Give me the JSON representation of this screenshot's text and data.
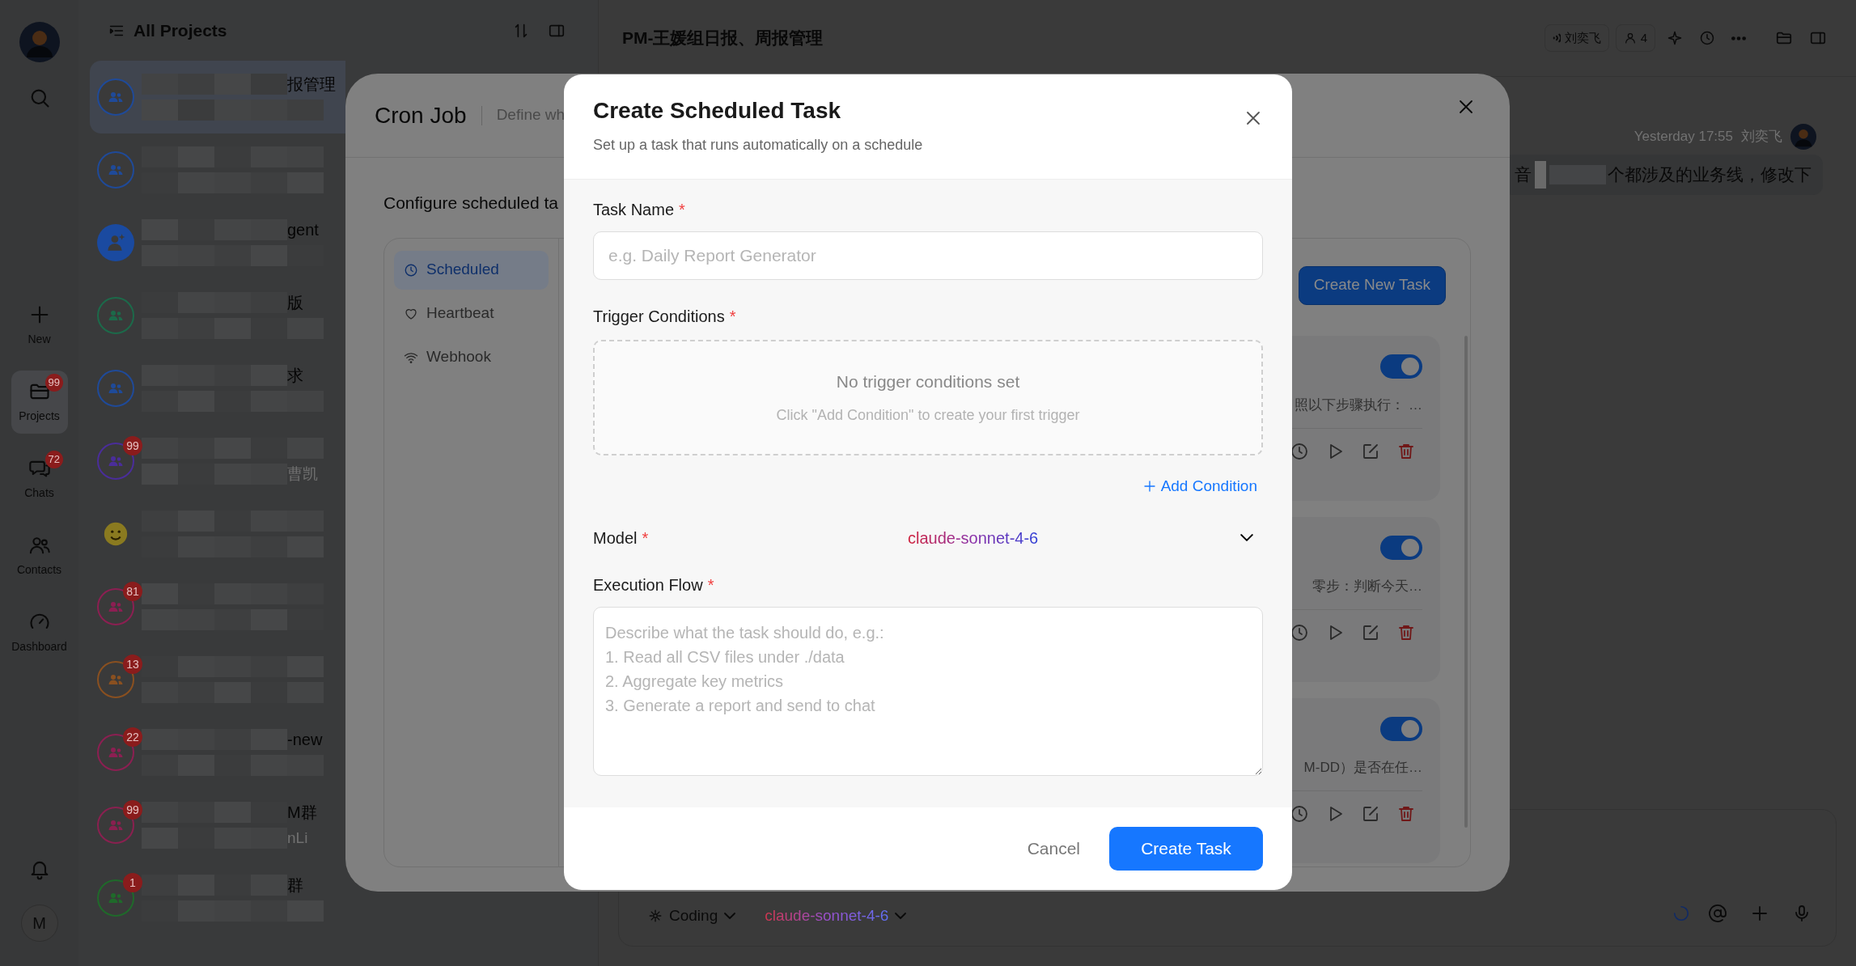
{
  "rail": {
    "items": [
      {
        "kind": "new",
        "label": "New",
        "selected": false
      },
      {
        "kind": "projects",
        "label": "Projects",
        "badge": "99",
        "selected": true
      },
      {
        "kind": "chats",
        "label": "Chats",
        "badge": "72",
        "selected": false
      },
      {
        "kind": "contacts",
        "label": "Contacts",
        "selected": false
      },
      {
        "kind": "dashboard",
        "label": "Dashboard",
        "selected": false
      }
    ],
    "user_initial": "M"
  },
  "projects": {
    "title": "All Projects",
    "items": [
      {
        "kind": "group",
        "color": "#1f4a99",
        "selected": true,
        "title": "报管理"
      },
      {
        "kind": "group",
        "color": "#1f4a99",
        "selected": false
      },
      {
        "kind": "bot",
        "color": "#1a4aa0",
        "selected": false,
        "title": "gent"
      },
      {
        "kind": "group",
        "color": "#1c6a4a",
        "selected": false,
        "title": "版"
      },
      {
        "kind": "group",
        "color": "#1f4a99",
        "selected": false,
        "title": "求"
      },
      {
        "kind": "group",
        "color": "#4a2d9a",
        "selected": false,
        "badge": "99",
        "subtitle": "曹凯"
      },
      {
        "kind": "emoji",
        "color": "#8a7a20",
        "selected": false
      },
      {
        "kind": "group",
        "color": "#8c1f52",
        "selected": false,
        "badge": "81"
      },
      {
        "kind": "group",
        "color": "#8a5020",
        "selected": false,
        "badge": "13"
      },
      {
        "kind": "group",
        "color": "#8c1f52",
        "selected": false,
        "badge": "22",
        "title": "-new"
      },
      {
        "kind": "group",
        "color": "#8a2050",
        "selected": false,
        "badge": "99",
        "title": "M群",
        "subtitle": "nLi"
      },
      {
        "kind": "group",
        "color": "#1f6a2a",
        "selected": false,
        "badge": "1",
        "title": "群"
      }
    ]
  },
  "chat": {
    "title": "PM-王媛组日报、周报管理",
    "speaker": "刘奕飞",
    "member_count": "4",
    "message": {
      "time": "Yesterday 17:55",
      "sender": "刘奕飞",
      "text_start": "音",
      "text_end": "个都涉及的业务线，修改下"
    },
    "composer": {
      "mode": "Coding",
      "model": "claude-sonnet-4-6"
    }
  },
  "cron": {
    "title": "Cron Job",
    "description": "Define wh",
    "intro": "Configure scheduled ta",
    "tabs": [
      {
        "kind": "clock",
        "label": "Scheduled",
        "selected": true
      },
      {
        "kind": "heart",
        "label": "Heartbeat",
        "selected": false
      },
      {
        "kind": "wifi",
        "label": "Webhook",
        "selected": false
      }
    ],
    "create_button": "Create New Task",
    "tasks": [
      {
        "enabled": true,
        "summary": "照以下步骤执行： …"
      },
      {
        "enabled": true,
        "summary": "零步：判断今天…"
      },
      {
        "enabled": true,
        "summary": "M-DD）是否在任…"
      }
    ]
  },
  "create_task": {
    "title": "Create Scheduled Task",
    "subtitle": "Set up a task that runs automatically on a schedule",
    "fields": [
      {
        "kind": "text",
        "label": "Task Name",
        "required_mark": "*",
        "placeholder": "e.g. Daily Report Generator"
      },
      {
        "kind": "triggers",
        "label": "Trigger Conditions",
        "required_mark": "*",
        "empty_title": "No trigger conditions set",
        "empty_hint": "Click \"Add Condition\" to create your first trigger",
        "add_label": "Add Condition"
      },
      {
        "kind": "select",
        "label": "Model",
        "required_mark": "*",
        "value": "claude-sonnet-4-6"
      },
      {
        "kind": "textarea",
        "label": "Execution Flow",
        "required_mark": "*",
        "placeholder": "Describe what the task should do, e.g.:\n1. Read all CSV files under ./data\n2. Aggregate key metrics\n3. Generate a report and send to chat"
      }
    ],
    "cancel": "Cancel",
    "submit": "Create Task"
  }
}
